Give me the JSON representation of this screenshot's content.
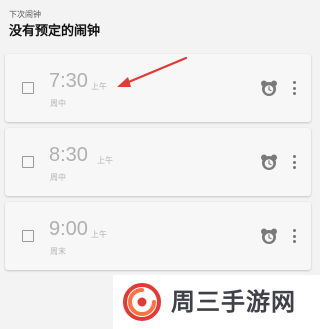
{
  "header": {
    "subtitle": "下次闹钟",
    "title": "没有预定的闹钟"
  },
  "alarms": [
    {
      "time": "7:30",
      "ampm": "上午",
      "repeat": "周中",
      "enabled": false
    },
    {
      "time": "8:30",
      "ampm": "上午",
      "repeat": "周中",
      "enabled": false
    },
    {
      "time": "9:00",
      "ampm": "上午",
      "repeat": "周末",
      "enabled": false
    }
  ],
  "icons": {
    "checkbox": "checkbox-icon",
    "bear": "bear-icon",
    "more": "more-vert-icon"
  },
  "annotation": {
    "color": "#e53935"
  },
  "watermark": {
    "text": "周三手游网",
    "logo_colors": [
      "#e53935",
      "#ff7043"
    ]
  }
}
